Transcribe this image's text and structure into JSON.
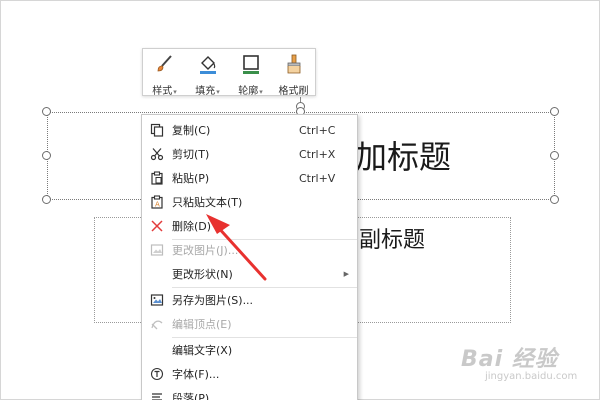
{
  "slide": {
    "title_visible": "加标题",
    "subtitle_visible": "副标题"
  },
  "toolbar": {
    "items": [
      {
        "label": "样式",
        "icon": "brush-style-icon",
        "has_dropdown": true
      },
      {
        "label": "填充",
        "icon": "fill-bucket-icon",
        "has_dropdown": true
      },
      {
        "label": "轮廓",
        "icon": "outline-icon",
        "has_dropdown": true
      },
      {
        "label": "格式刷",
        "icon": "format-painter-icon",
        "has_dropdown": false
      }
    ]
  },
  "menu": {
    "items": [
      {
        "label": "复制(C)",
        "shortcut": "Ctrl+C",
        "icon": "copy-icon",
        "disabled": false
      },
      {
        "label": "剪切(T)",
        "shortcut": "Ctrl+X",
        "icon": "scissors-icon",
        "disabled": false
      },
      {
        "label": "粘贴(P)",
        "shortcut": "Ctrl+V",
        "icon": "paste-icon",
        "disabled": false
      },
      {
        "label": "只粘贴文本(T)",
        "shortcut": "",
        "icon": "paste-text-icon",
        "disabled": false
      },
      {
        "label": "删除(D)",
        "shortcut": "",
        "icon": "delete-x-icon",
        "disabled": false
      },
      {
        "label": "更改图片(J)...",
        "shortcut": "",
        "icon": "change-picture-icon",
        "disabled": true
      },
      {
        "label": "更改形状(N)",
        "shortcut": "",
        "icon": "",
        "disabled": false,
        "submenu": true
      },
      {
        "label": "另存为图片(S)...",
        "shortcut": "",
        "icon": "save-picture-icon",
        "disabled": false
      },
      {
        "label": "编辑顶点(E)",
        "shortcut": "",
        "icon": "edit-points-icon",
        "disabled": true
      },
      {
        "label": "编辑文字(X)",
        "shortcut": "",
        "icon": "",
        "disabled": false
      },
      {
        "label": "字体(F)...",
        "shortcut": "",
        "icon": "font-icon",
        "disabled": false
      },
      {
        "label": "段落(P)...",
        "shortcut": "",
        "icon": "paragraph-icon",
        "disabled": false
      }
    ]
  },
  "watermark": {
    "brand": "Bai  经验",
    "url": "jingyan.baidu.com"
  },
  "colors": {
    "delete_icon": "#e23b3b",
    "annotation_arrow": "#e8312f",
    "disabled_text": "#a8a8a8"
  }
}
